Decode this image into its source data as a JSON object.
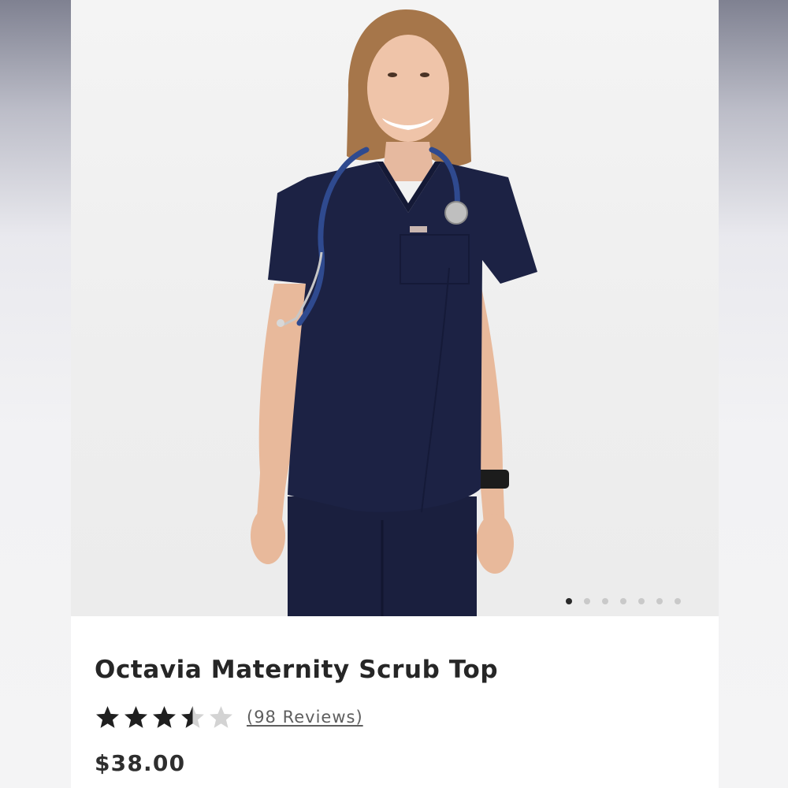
{
  "product": {
    "title": "Octavia Maternity Scrub Top",
    "rating": 3.5,
    "rating_max": 5,
    "reviews_label": "(98 Reviews)",
    "price": "$38.00"
  },
  "gallery": {
    "image_subject": "model-in-navy-scrubs",
    "slide_count": 7,
    "active_slide": 1
  },
  "colors": {
    "star_filled": "#1f1f1f",
    "star_empty": "#d3d3d3",
    "scrubs_navy": "#1b2143",
    "dot_active": "#2a2a2a",
    "dot_inactive": "#c9c9c9"
  }
}
